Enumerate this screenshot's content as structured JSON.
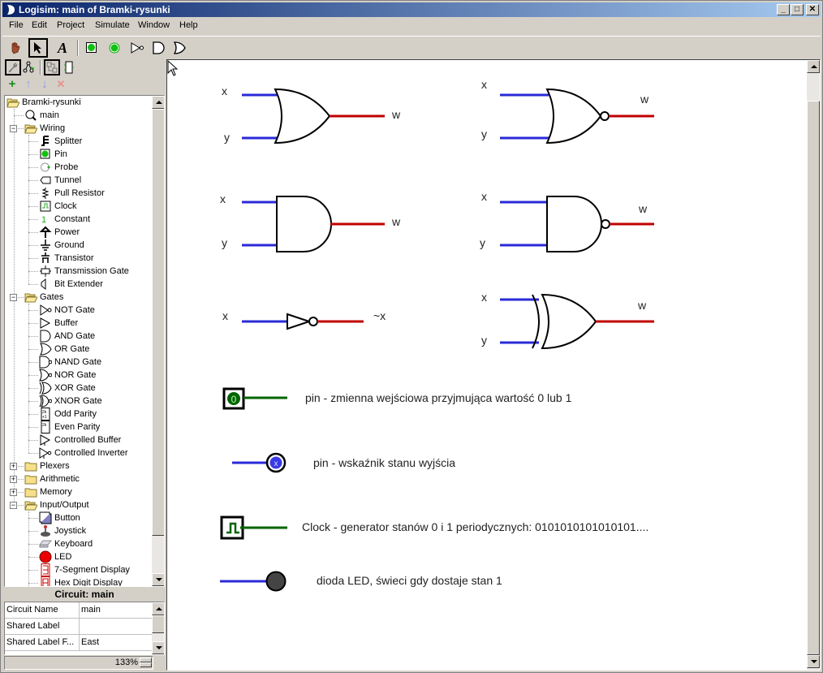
{
  "window": {
    "title": "Logisim: main of Bramki-rysunki",
    "controls": [
      "minimize",
      "maximize",
      "close"
    ]
  },
  "menu": [
    "File",
    "Edit",
    "Project",
    "Simulate",
    "Window",
    "Help"
  ],
  "toolbar": {
    "tools": [
      {
        "name": "poke-tool",
        "icon": "hand-icon",
        "selected": false
      },
      {
        "name": "select-tool",
        "icon": "arrow-icon",
        "selected": true
      },
      {
        "name": "text-tool",
        "icon": "text-A-icon",
        "selected": false
      },
      {
        "name": "add-input-pin",
        "icon": "pin-input-icon",
        "selected": false
      },
      {
        "name": "add-output-pin",
        "icon": "pin-output-icon",
        "selected": false
      },
      {
        "name": "add-not-gate",
        "icon": "not-gate-icon",
        "selected": false
      },
      {
        "name": "add-and-gate",
        "icon": "and-gate-icon",
        "selected": false
      },
      {
        "name": "add-or-gate",
        "icon": "or-gate-icon",
        "selected": false
      }
    ]
  },
  "explorer": {
    "view_tools": [
      "toolbox-view",
      "simulation-tree-view",
      "main-circuit-layout",
      "circuit-appearance"
    ],
    "project_tools": {
      "add": "+",
      "move_up": "↑",
      "move_down": "↓",
      "remove": "✕"
    },
    "tree": [
      {
        "label": "Bramki-rysunki",
        "level": 0,
        "type": "folder-open",
        "expander": ""
      },
      {
        "label": "main",
        "level": 1,
        "type": "circuit",
        "expander": ""
      },
      {
        "label": "Wiring",
        "level": 1,
        "type": "folder-open",
        "expander": "-"
      },
      {
        "label": "Splitter",
        "level": 2,
        "type": "splitter"
      },
      {
        "label": "Pin",
        "level": 2,
        "type": "pin"
      },
      {
        "label": "Probe",
        "level": 2,
        "type": "probe"
      },
      {
        "label": "Tunnel",
        "level": 2,
        "type": "tunnel"
      },
      {
        "label": "Pull Resistor",
        "level": 2,
        "type": "resistor"
      },
      {
        "label": "Clock",
        "level": 2,
        "type": "clock"
      },
      {
        "label": "Constant",
        "level": 2,
        "type": "constant"
      },
      {
        "label": "Power",
        "level": 2,
        "type": "power"
      },
      {
        "label": "Ground",
        "level": 2,
        "type": "ground"
      },
      {
        "label": "Transistor",
        "level": 2,
        "type": "transistor"
      },
      {
        "label": "Transmission Gate",
        "level": 2,
        "type": "transmission"
      },
      {
        "label": "Bit Extender",
        "level": 2,
        "type": "extender"
      },
      {
        "label": "Gates",
        "level": 1,
        "type": "folder-open",
        "expander": "-"
      },
      {
        "label": "NOT Gate",
        "level": 2,
        "type": "not"
      },
      {
        "label": "Buffer",
        "level": 2,
        "type": "buffer"
      },
      {
        "label": "AND Gate",
        "level": 2,
        "type": "and"
      },
      {
        "label": "OR Gate",
        "level": 2,
        "type": "or"
      },
      {
        "label": "NAND Gate",
        "level": 2,
        "type": "nand"
      },
      {
        "label": "NOR Gate",
        "level": 2,
        "type": "nor"
      },
      {
        "label": "XOR Gate",
        "level": 2,
        "type": "xor"
      },
      {
        "label": "XNOR Gate",
        "level": 2,
        "type": "xnor"
      },
      {
        "label": "Odd Parity",
        "level": 2,
        "type": "odd"
      },
      {
        "label": "Even Parity",
        "level": 2,
        "type": "even"
      },
      {
        "label": "Controlled Buffer",
        "level": 2,
        "type": "cbuffer"
      },
      {
        "label": "Controlled Inverter",
        "level": 2,
        "type": "cinverter"
      },
      {
        "label": "Plexers",
        "level": 1,
        "type": "folder",
        "expander": "+"
      },
      {
        "label": "Arithmetic",
        "level": 1,
        "type": "folder",
        "expander": "+"
      },
      {
        "label": "Memory",
        "level": 1,
        "type": "folder",
        "expander": "+"
      },
      {
        "label": "Input/Output",
        "level": 1,
        "type": "folder-open",
        "expander": "-"
      },
      {
        "label": "Button",
        "level": 2,
        "type": "button"
      },
      {
        "label": "Joystick",
        "level": 2,
        "type": "joystick"
      },
      {
        "label": "Keyboard",
        "level": 2,
        "type": "keyboard"
      },
      {
        "label": "LED",
        "level": 2,
        "type": "led"
      },
      {
        "label": "7-Segment Display",
        "level": 2,
        "type": "seg7"
      },
      {
        "label": "Hex Digit Display",
        "level": 2,
        "type": "hex"
      }
    ]
  },
  "properties": {
    "header": "Circuit: main",
    "rows": [
      {
        "key": "Circuit Name",
        "value": "main"
      },
      {
        "key": "Shared Label",
        "value": ""
      },
      {
        "key": "Shared Label F...",
        "value": "East"
      }
    ]
  },
  "zoom": {
    "value": "133%"
  },
  "canvas": {
    "colors": {
      "input_wire": "#2a2ad8",
      "output_wire": "#c00000",
      "pin_wire": "#006400",
      "gate_stroke": "#000000"
    },
    "gates": [
      {
        "type": "OR",
        "inputs": [
          "x",
          "y"
        ],
        "output": "w"
      },
      {
        "type": "NOR",
        "inputs": [
          "x",
          "y"
        ],
        "output": "w"
      },
      {
        "type": "AND",
        "inputs": [
          "x",
          "y"
        ],
        "output": "w"
      },
      {
        "type": "NAND",
        "inputs": [
          "x",
          "y"
        ],
        "output": "w"
      },
      {
        "type": "NOT",
        "inputs": [
          "x"
        ],
        "output": "~x"
      },
      {
        "type": "XNOR",
        "inputs": [
          "x",
          "y"
        ],
        "output": "w"
      }
    ],
    "legend": [
      {
        "component": "input-pin",
        "value": "0",
        "text": "pin  - zmienna wejściowa przyjmująca wartość 0 lub 1"
      },
      {
        "component": "output-pin",
        "value": "x",
        "text": "pin  - wskaźnik stanu wyjścia"
      },
      {
        "component": "clock",
        "text": "Clock - generator stanów  0 i 1  periodycznych:   0101010101010101...."
      },
      {
        "component": "led",
        "text": "dioda LED, świeci gdy dostaje stan  1"
      }
    ]
  }
}
